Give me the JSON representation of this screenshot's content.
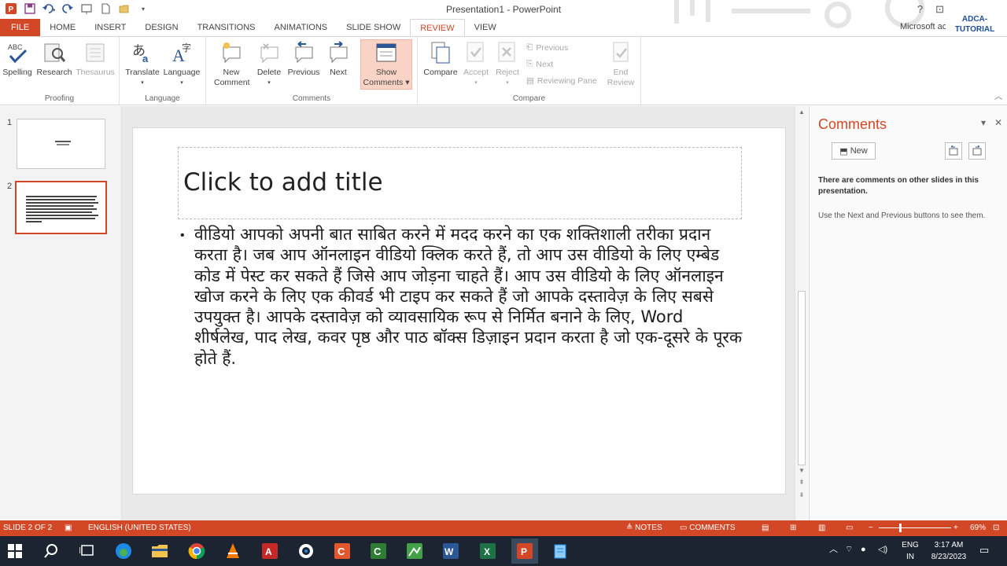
{
  "window": {
    "title": "Presentation1 - PowerPoint",
    "help": "?",
    "account": "Microsoft ac",
    "brand": "ADCA-\nTUTORIAL"
  },
  "tabs": [
    "FILE",
    "HOME",
    "INSERT",
    "DESIGN",
    "TRANSITIONS",
    "ANIMATIONS",
    "SLIDE SHOW",
    "REVIEW",
    "VIEW"
  ],
  "active_tab": "REVIEW",
  "ribbon": {
    "proofing": {
      "label": "Proofing",
      "spelling": "Spelling",
      "research": "Research",
      "thesaurus": "Thesaurus"
    },
    "language": {
      "label": "Language",
      "translate": "Translate",
      "language": "Language"
    },
    "comments": {
      "label": "Comments",
      "new_line1": "New",
      "new_line2": "Comment",
      "delete": "Delete",
      "previous": "Previous",
      "next": "Next",
      "show_line1": "Show",
      "show_line2": "Comments"
    },
    "compare": {
      "label": "Compare",
      "compare": "Compare",
      "accept": "Accept",
      "reject": "Reject",
      "previous": "Previous",
      "next": "Next",
      "reviewing_pane": "Reviewing Pane",
      "end_line1": "End",
      "end_line2": "Review"
    }
  },
  "slides": {
    "numbers": [
      "1",
      "2"
    ]
  },
  "slide": {
    "title_placeholder": "Click to add title",
    "body": "वीडियो आपको अपनी बात साबित करने में मदद करने का एक शक्तिशाली तरीका प्रदान करता है। जब आप ऑनलाइन वीडियो क्लिक करते हैं, तो आप उस वीडियो के लिए एम्बेड कोड में पेस्ट कर सकते हैं जिसे आप जोड़ना चाहते हैं। आप उस वीडियो के लिए ऑनलाइन खोज करने के लिए एक कीवर्ड भी टाइप कर सकते हैं जो आपके दस्तावेज़ के लिए सबसे उपयुक्त है। आपके दस्तावेज़ को व्यावसायिक रूप से निर्मित बनाने के लिए, Word शीर्षलेख, पाद लेख, कवर पृष्ठ और पाठ बॉक्स डिज़ाइन प्रदान करता है जो एक-दूसरे के पूरक होते हैं."
  },
  "comments_pane": {
    "title": "Comments",
    "new_button": "New",
    "message": "There are comments on other slides in this presentation.",
    "hint": "Use the Next and Previous buttons to see them."
  },
  "status_bar": {
    "slide_info": "SLIDE 2 OF 2",
    "language": "ENGLISH (UNITED STATES)",
    "notes": "NOTES",
    "comments": "COMMENTS",
    "zoom": "69%"
  },
  "taskbar": {
    "lang": "ENG",
    "region": "IN",
    "time": "3:17 AM",
    "date": "8/23/2023"
  },
  "colors": {
    "accent": "#d24726",
    "taskbar": "#1b2430"
  }
}
